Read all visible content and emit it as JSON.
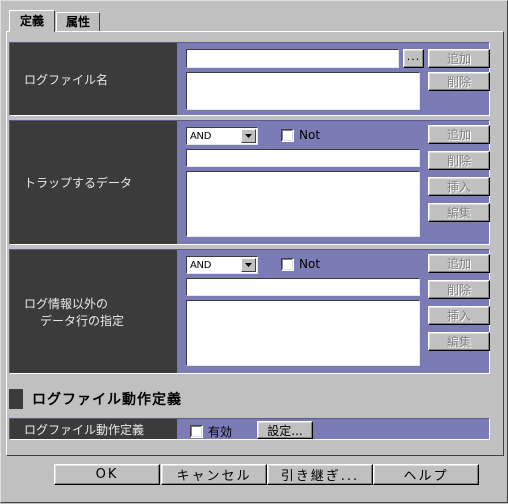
{
  "dialog": {
    "tabs": [
      {
        "label": "定義",
        "active": true
      },
      {
        "label": "属性",
        "active": false
      }
    ]
  },
  "sections": [
    {
      "id": "logfile-name",
      "label_line1": "ログファイル名",
      "label_line2": "",
      "text_value": "",
      "list_value": "",
      "browse_label": "...",
      "buttons": [
        {
          "label": "追加",
          "disabled": true
        },
        {
          "label": "削除",
          "disabled": true
        }
      ]
    },
    {
      "id": "trap-data",
      "label_line1": "トラップするデータ",
      "label_line2": "",
      "combo_value": "AND",
      "not_label": "Not",
      "not_checked": false,
      "text_value": "",
      "list_value": "",
      "buttons": [
        {
          "label": "追加",
          "disabled": true
        },
        {
          "label": "削除",
          "disabled": true
        },
        {
          "label": "挿入",
          "disabled": true
        },
        {
          "label": "編集",
          "disabled": true
        }
      ]
    },
    {
      "id": "non-log-data-lines",
      "label_line1": "ログ情報以外の",
      "label_line2": "データ行の指定",
      "combo_value": "AND",
      "not_label": "Not",
      "not_checked": false,
      "text_value": "",
      "list_value": "",
      "buttons": [
        {
          "label": "追加",
          "disabled": true
        },
        {
          "label": "削除",
          "disabled": true
        },
        {
          "label": "挿入",
          "disabled": true
        },
        {
          "label": "編集",
          "disabled": true
        }
      ]
    }
  ],
  "behavior_group": {
    "title": "ログファイル動作定義",
    "row_label": "ログファイル動作定義",
    "enable_label": "有効",
    "enable_checked": false,
    "settings_label": "設定..."
  },
  "footer": {
    "buttons": [
      {
        "id": "ok",
        "label": "OK"
      },
      {
        "id": "cancel",
        "label": "キャンセル"
      },
      {
        "id": "inherit",
        "label": "引き継ぎ..."
      },
      {
        "id": "help",
        "label": "ヘルプ"
      }
    ]
  },
  "colors": {
    "face": "#c0c0c0",
    "accent_purple": "#7b7bb5",
    "label_dark": "#3b3b3b",
    "field_white": "#ffffff",
    "disabled_text": "#808080"
  }
}
